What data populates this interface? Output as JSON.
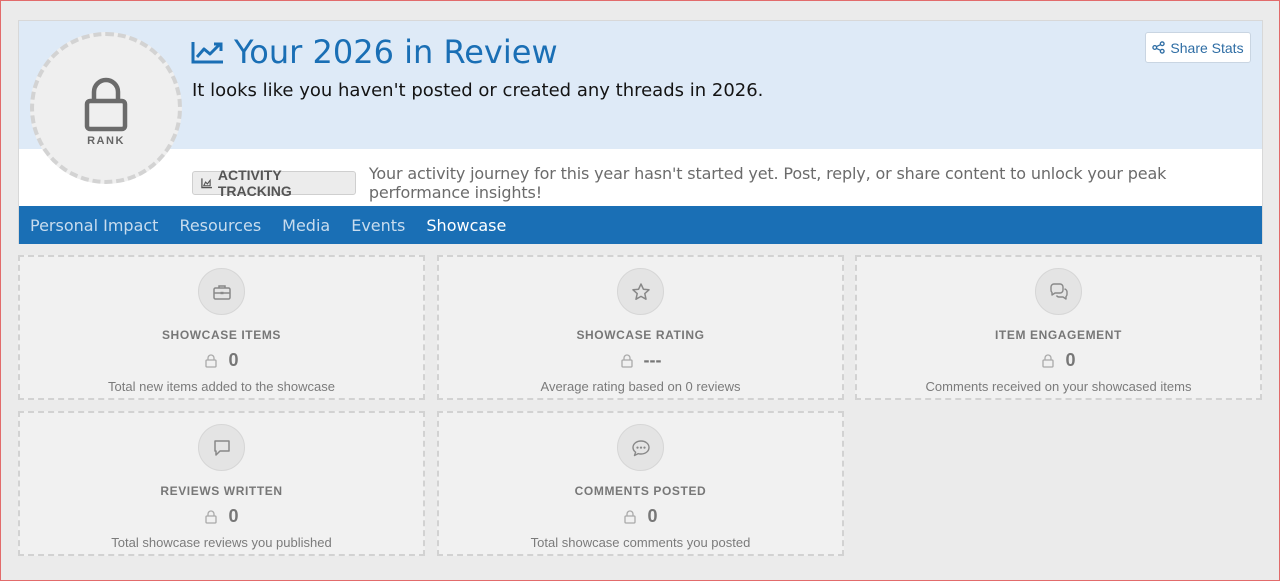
{
  "header": {
    "title": "Your 2026 in Review",
    "subtitle": "It looks like you haven't posted or created any threads in 2026.",
    "rank_label": "RANK",
    "share_label": "Share Stats",
    "tracking_badge": "ACTIVITY TRACKING",
    "tracking_text": "Your activity journey for this year hasn't started yet. Post, reply, or share content to unlock your peak performance insights!"
  },
  "tabs": [
    {
      "label": "Personal Impact"
    },
    {
      "label": "Resources"
    },
    {
      "label": "Media"
    },
    {
      "label": "Events"
    },
    {
      "label": "Showcase",
      "active": true
    }
  ],
  "cards": [
    {
      "icon": "briefcase-icon",
      "label": "SHOWCASE ITEMS",
      "value": "0",
      "desc": "Total new items added to the showcase"
    },
    {
      "icon": "star-icon",
      "label": "SHOWCASE RATING",
      "value": "---",
      "desc": "Average rating based on 0 reviews"
    },
    {
      "icon": "comments-icon",
      "label": "ITEM ENGAGEMENT",
      "value": "0",
      "desc": "Comments received on your showcased items"
    },
    {
      "icon": "comment-icon",
      "label": "REVIEWS WRITTEN",
      "value": "0",
      "desc": "Total showcase reviews you published"
    },
    {
      "icon": "comment-dots-icon",
      "label": "COMMENTS POSTED",
      "value": "0",
      "desc": "Total showcase comments you posted"
    }
  ],
  "colors": {
    "accent": "#1a6fb5",
    "hero_bg": "#deeaf7",
    "page_bg": "#ebebeb"
  }
}
